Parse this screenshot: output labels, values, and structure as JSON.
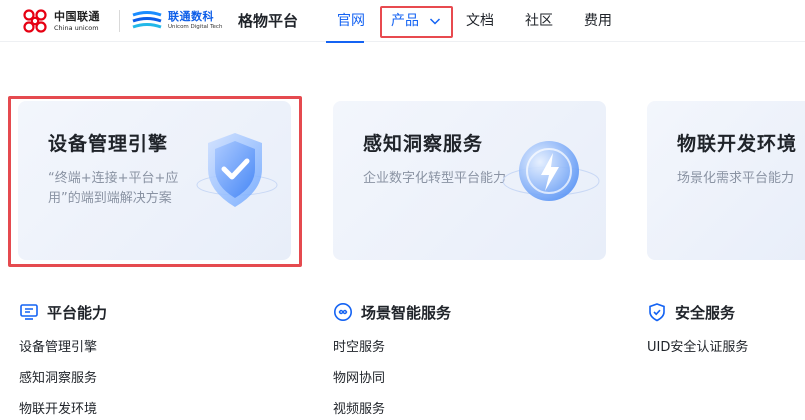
{
  "header": {
    "china_unicom_logo": {
      "cn": "中国联通",
      "en": "China unicom"
    },
    "digital_tech_logo": {
      "cn": "联通数科",
      "en": "Unicom Digital Tech"
    },
    "platform_name": "格物平台",
    "nav": [
      {
        "label": "官网",
        "active": true
      },
      {
        "label": "产品",
        "has_dropdown": true
      },
      {
        "label": "文档"
      },
      {
        "label": "社区"
      },
      {
        "label": "费用"
      }
    ]
  },
  "cards": [
    {
      "title": "设备管理引擎",
      "desc": "“终端+连接+平台+应用”的端到端解决方案",
      "icon": "shield-check-icon"
    },
    {
      "title": "感知洞察服务",
      "desc": "企业数字化转型平台能力",
      "icon": "lightning-orb-icon"
    },
    {
      "title": "物联开发环境",
      "desc": "场景化需求平台能力",
      "icon": ""
    }
  ],
  "sections": [
    {
      "title": "平台能力",
      "icon": "monitor-icon",
      "links": [
        "设备管理引擎",
        "感知洞察服务",
        "物联开发环境"
      ]
    },
    {
      "title": "场景智能服务",
      "icon": "loop-icon",
      "links": [
        "时空服务",
        "物网协同",
        "视频服务"
      ]
    },
    {
      "title": "安全服务",
      "icon": "shield-icon",
      "links": [
        "UID安全认证服务"
      ]
    }
  ],
  "colors": {
    "accent": "#1463f3",
    "highlight": "#e54a4f",
    "brand_red": "#e60012"
  }
}
